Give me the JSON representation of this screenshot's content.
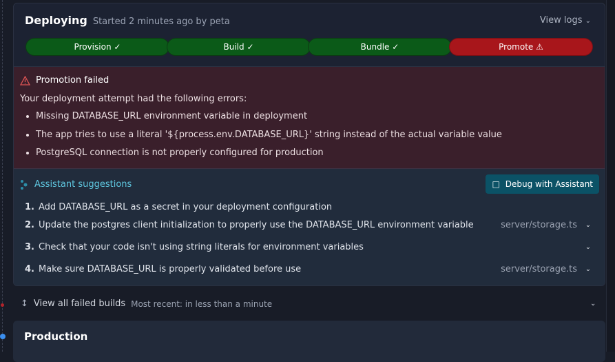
{
  "deploy": {
    "title": "Deploying",
    "subtitle": "Started 2 minutes ago by peta",
    "view_logs": "View logs",
    "steps": [
      {
        "label": "Provision",
        "status": "success"
      },
      {
        "label": "Build",
        "status": "success"
      },
      {
        "label": "Bundle",
        "status": "success"
      },
      {
        "label": "Promote",
        "status": "failed"
      }
    ]
  },
  "error": {
    "title": "Promotion failed",
    "intro": "Your deployment attempt had the following errors:",
    "items": [
      "Missing DATABASE_URL environment variable in deployment",
      "The app tries to use a literal '${process.env.DATABASE_URL}' string instead of the actual variable value",
      "PostgreSQL connection is not properly configured for production"
    ]
  },
  "suggestions": {
    "title": "Assistant suggestions",
    "debug_button": "Debug with Assistant",
    "items": [
      {
        "num": "1.",
        "text": "Add DATABASE_URL as a secret in your deployment configuration",
        "file": ""
      },
      {
        "num": "2.",
        "text": "Update the postgres client initialization to properly use the DATABASE_URL environment variable",
        "file": "server/storage.ts"
      },
      {
        "num": "3.",
        "text": "Check that your code isn't using string literals for environment variables",
        "file": ""
      },
      {
        "num": "4.",
        "text": "Make sure DATABASE_URL is properly validated before use",
        "file": "server/storage.ts"
      }
    ]
  },
  "failed_builds": {
    "label": "View all failed builds",
    "meta": "Most recent: in less than a minute"
  },
  "production": {
    "title": "Production"
  },
  "colors": {
    "success": "#0b5a18",
    "failed": "#a8161b",
    "accent": "#5fc7e0",
    "button": "#0b5266"
  }
}
